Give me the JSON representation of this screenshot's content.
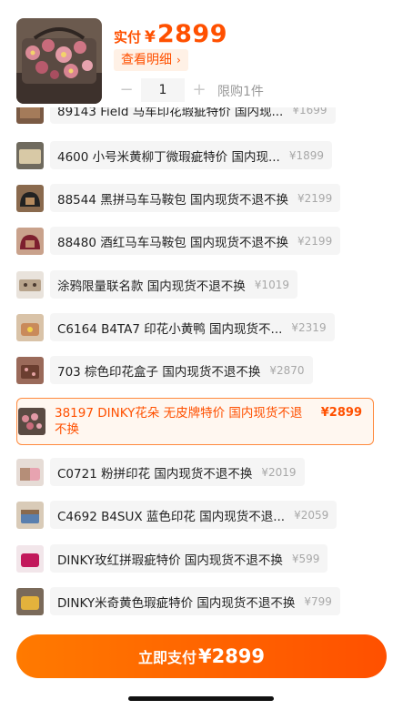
{
  "header": {
    "price_label": "实付",
    "currency": "¥",
    "price": "2899",
    "detail_label": "查看明细",
    "quantity": "1",
    "minus": "−",
    "plus": "+",
    "limit_text": "限购1件"
  },
  "items": [
    {
      "name": "89143 Field 马车印花瑕疵特价 国内现...",
      "price": "¥1699",
      "thumb": "brown-bag"
    },
    {
      "name": "4600 小号米黄柳丁微瑕疵特价 国内现...",
      "price": "¥1899",
      "thumb": "beige-bag"
    },
    {
      "name": "88544 黑拼马车马鞍包 国内现货不退不换",
      "price": "¥2199",
      "thumb": "black-saddle"
    },
    {
      "name": "88480 酒红马车马鞍包 国内现货不退不换",
      "price": "¥2199",
      "thumb": "wine-saddle"
    },
    {
      "name": "涂鸦限量联名款 国内现货不退不换",
      "price": "¥1019",
      "thumb": "graffiti"
    },
    {
      "name": "C6164 B4TA7 印花小黄鸭 国内现货不...",
      "price": "¥2319",
      "thumb": "duck"
    },
    {
      "name": "703 棕色印花盒子 国内现货不退不换",
      "price": "¥2870",
      "thumb": "box"
    },
    {
      "name": "C0721 粉拼印花 国内现货不退不换",
      "price": "¥2019",
      "thumb": "pink"
    },
    {
      "name": "C4692 B4SUX 蓝色印花 国内现货不退...",
      "price": "¥2059",
      "thumb": "blue"
    },
    {
      "name": "DINKY玫红拼瑕疵特价 国内现货不退不换",
      "price": "¥599",
      "thumb": "rose"
    },
    {
      "name": "DINKY米奇黄色瑕疵特价 国内现货不退不换",
      "price": "¥799",
      "thumb": "yellow"
    }
  ],
  "selected": {
    "name": "38197 DINKY花朵 无皮牌特价 国内现货不退不换",
    "price": "¥2899"
  },
  "pay": {
    "label": "立即支付",
    "amount": "¥2899"
  },
  "colors": {
    "accent": "#ff5000",
    "accent_light": "#fff1e6"
  }
}
